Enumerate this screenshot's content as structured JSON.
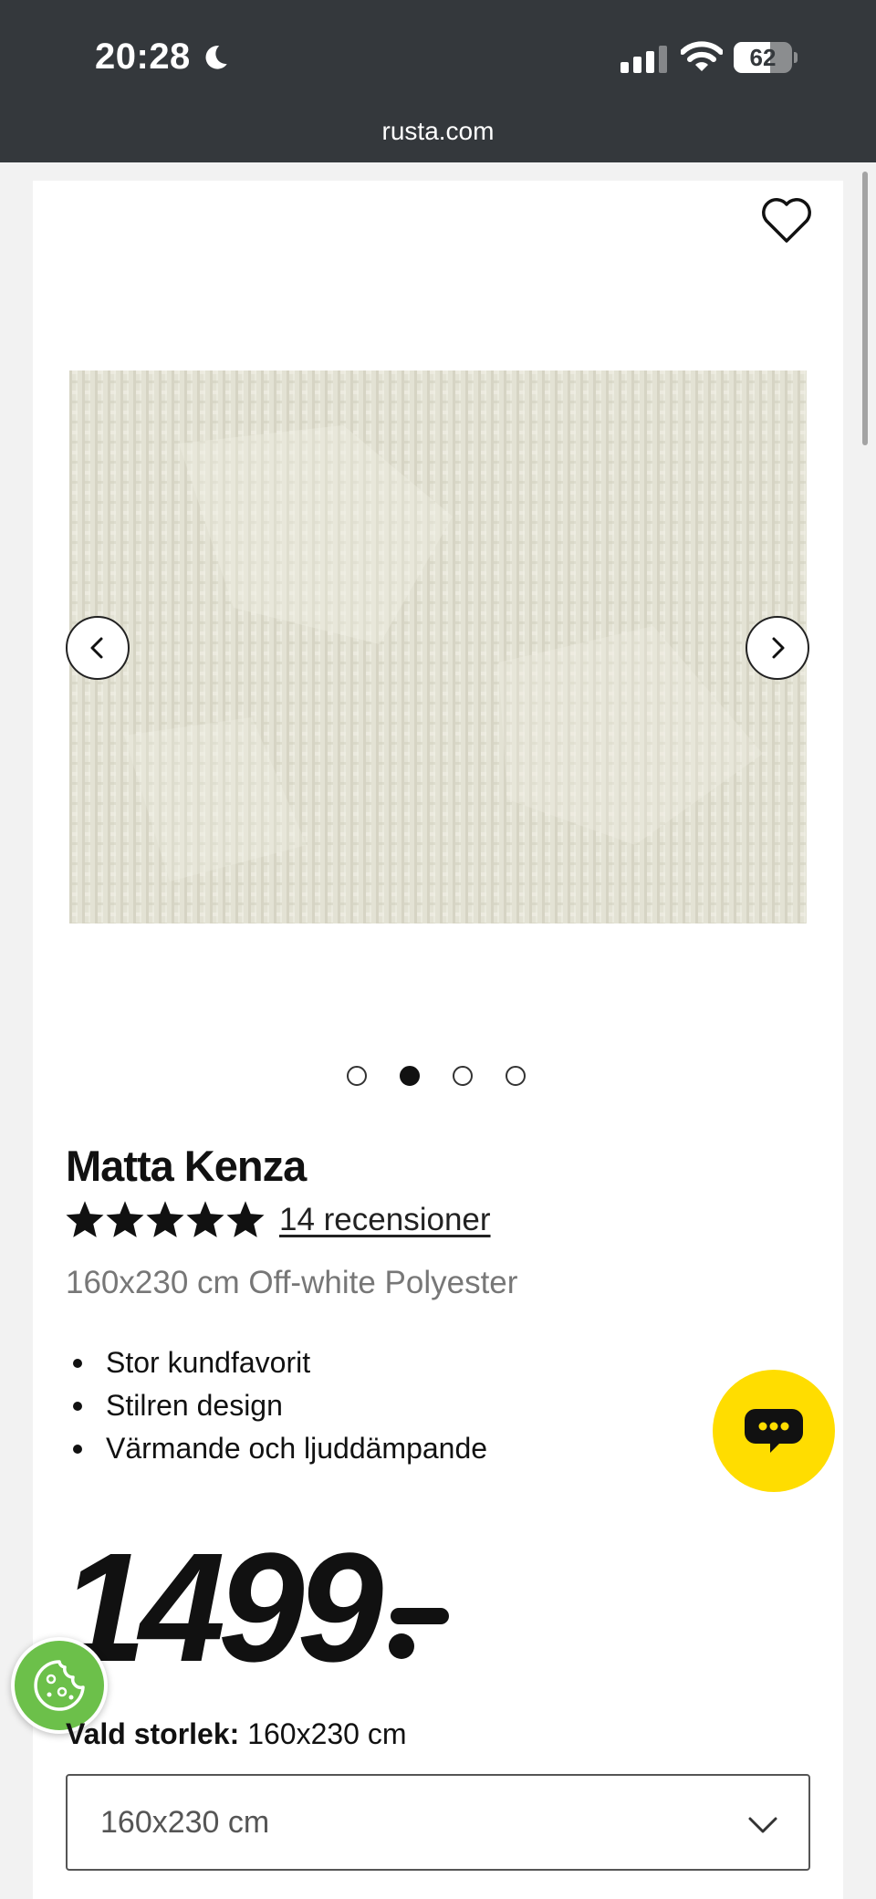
{
  "status_bar": {
    "time": "20:28",
    "battery": "62",
    "battery_level": 0.62,
    "url": "rusta.com"
  },
  "icons": {
    "moon": "moon-icon",
    "signal": "signal-icon",
    "wifi": "wifi-icon",
    "battery": "battery-icon",
    "favorite": "heart-icon",
    "prev": "chevron-left-icon",
    "next": "chevron-right-icon",
    "chat": "chat-icon",
    "cookie": "cookie-icon",
    "dropdown": "chevron-down-icon"
  },
  "gallery": {
    "slides": 4,
    "active_index": 1
  },
  "product": {
    "title": "Matta Kenza",
    "rating": 5,
    "reviews_label": "14 recensioner",
    "variant": "160x230 cm Off-white Polyester",
    "bullets": [
      "Stor kundfavorit",
      "Stilren design",
      "Värmande och ljuddämpande"
    ],
    "price": "1499"
  },
  "size": {
    "label": "Vald storlek:",
    "value": "160x230 cm",
    "select_value": "160x230 cm"
  },
  "colors": {
    "statusbar": "#34383c",
    "chat_accent": "#ffdd00",
    "cookie_accent": "#6cc04a",
    "rug": "#e2e1d3"
  }
}
